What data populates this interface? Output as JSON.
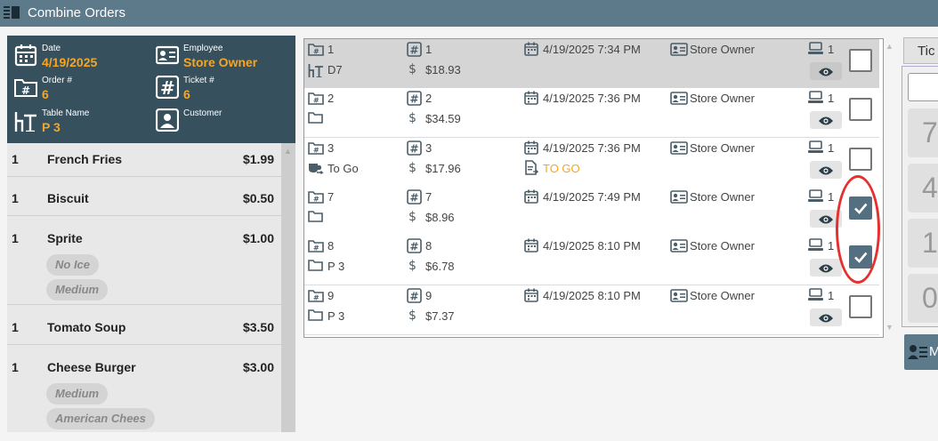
{
  "window": {
    "title": "Combine Orders"
  },
  "ticket": {
    "date_label": "Date",
    "date": "4/19/2025",
    "employee_label": "Employee",
    "employee": "Store Owner",
    "order_label": "Order #",
    "order": "6",
    "ticket_label": "Ticket #",
    "ticket": "6",
    "table_label": "Table Name",
    "table": "P 3",
    "customer_label": "Customer",
    "customer": ""
  },
  "items": [
    {
      "qty": "1",
      "name": "French Fries",
      "price": "$1.99",
      "modifiers": []
    },
    {
      "qty": "1",
      "name": "Biscuit",
      "price": "$0.50",
      "modifiers": []
    },
    {
      "qty": "1",
      "name": "Sprite",
      "price": "$1.00",
      "modifiers": [
        "No Ice",
        "Medium"
      ]
    },
    {
      "qty": "1",
      "name": "Tomato Soup",
      "price": "$3.50",
      "modifiers": []
    },
    {
      "qty": "1",
      "name": "Cheese Burger",
      "price": "$3.00",
      "modifiers": [
        "Medium",
        "American Chees"
      ]
    }
  ],
  "orders": [
    {
      "order": "1",
      "ticket": "1",
      "datetime": "4/19/2025 7:34 PM",
      "employee": "Store Owner",
      "terminal": "1",
      "table": "D7",
      "table_icon": "table-icon",
      "total": "$18.93",
      "status": "",
      "selected_row": true,
      "checked": false
    },
    {
      "order": "2",
      "ticket": "2",
      "datetime": "4/19/2025 7:36 PM",
      "employee": "Store Owner",
      "terminal": "1",
      "table": "",
      "table_icon": "folder-icon",
      "total": "$34.59",
      "status": "",
      "selected_row": false,
      "checked": false
    },
    {
      "order": "3",
      "ticket": "3",
      "datetime": "4/19/2025 7:36 PM",
      "employee": "Store Owner",
      "terminal": "1",
      "table": "To Go",
      "table_icon": "to-go-icon",
      "total": "$17.96",
      "status": "TO GO",
      "selected_row": false,
      "checked": false
    },
    {
      "order": "7",
      "ticket": "7",
      "datetime": "4/19/2025 7:49 PM",
      "employee": "Store Owner",
      "terminal": "1",
      "table": "",
      "table_icon": "folder-icon",
      "total": "$8.96",
      "status": "",
      "selected_row": false,
      "checked": true
    },
    {
      "order": "8",
      "ticket": "8",
      "datetime": "4/19/2025 8:10 PM",
      "employee": "Store Owner",
      "terminal": "1",
      "table": "P 3",
      "table_icon": "folder-icon",
      "total": "$6.78",
      "status": "",
      "selected_row": false,
      "checked": true
    },
    {
      "order": "9",
      "ticket": "9",
      "datetime": "4/19/2025 8:10 PM",
      "employee": "Store Owner",
      "terminal": "1",
      "table": "P 3",
      "table_icon": "folder-icon",
      "total": "$7.37",
      "status": "",
      "selected_row": false,
      "checked": false
    }
  ],
  "right_panel": {
    "tab_label": "Tic",
    "keypad": [
      "7",
      "4",
      "1",
      "0"
    ],
    "button_label": "M"
  },
  "colors": {
    "accent": "#f5a623",
    "header": "#36505e",
    "titlebar": "#5d7a8b",
    "check": "#546f80",
    "annotation": "#e53030"
  }
}
